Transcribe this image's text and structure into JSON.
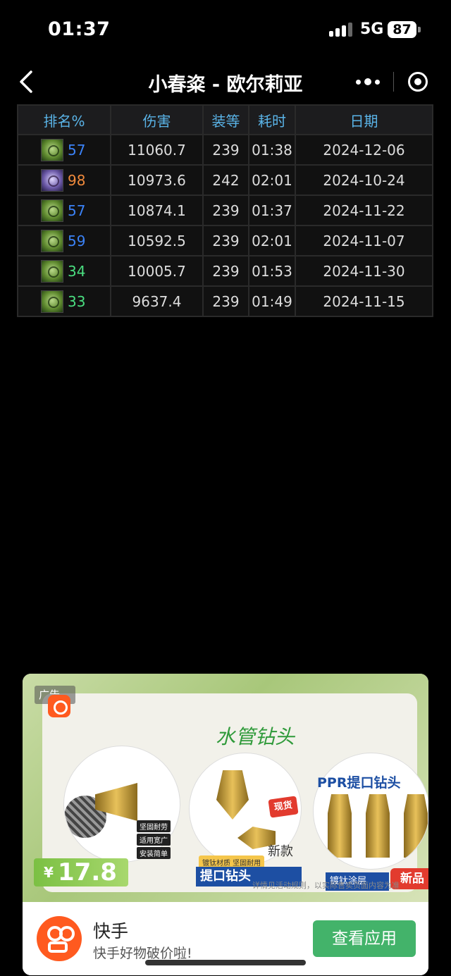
{
  "status": {
    "time": "01:37",
    "network": "5G",
    "battery": "87"
  },
  "nav": {
    "title": "小春粢 - 欧尔莉亚",
    "back_icon": "chevron-left-icon",
    "more_icon": "ellipsis-icon",
    "target_icon": "target-icon"
  },
  "table": {
    "headers": [
      "排名%",
      "伤害",
      "装等",
      "耗时",
      "日期"
    ],
    "rows": [
      {
        "spec": "green",
        "rank": "57",
        "rank_color": "#3b82f6",
        "damage": "11060.7",
        "ilvl": "239",
        "duration": "01:38",
        "date": "2024-12-06"
      },
      {
        "spec": "purple",
        "rank": "98",
        "rank_color": "#f08a3c",
        "damage": "10973.6",
        "ilvl": "242",
        "duration": "02:01",
        "date": "2024-10-24"
      },
      {
        "spec": "green",
        "rank": "57",
        "rank_color": "#3b82f6",
        "damage": "10874.1",
        "ilvl": "239",
        "duration": "01:37",
        "date": "2024-11-22"
      },
      {
        "spec": "green",
        "rank": "59",
        "rank_color": "#3b82f6",
        "damage": "10592.5",
        "ilvl": "239",
        "duration": "02:01",
        "date": "2024-11-07"
      },
      {
        "spec": "green",
        "rank": "34",
        "rank_color": "#4ade80",
        "damage": "10005.7",
        "ilvl": "239",
        "duration": "01:53",
        "date": "2024-11-30"
      },
      {
        "spec": "green",
        "rank": "33",
        "rank_color": "#4ade80",
        "damage": "9637.4",
        "ilvl": "239",
        "duration": "01:49",
        "date": "2024-11-15"
      }
    ]
  },
  "ad": {
    "tag": "广告",
    "headline": "水管钻头",
    "c3_title": "PPR提口钻头",
    "checks": [
      "坚固耐劳",
      "适用宽广",
      "安装简单"
    ],
    "instock": "现货",
    "material": "镀钛材质 坚固耐用",
    "strip1": "提口钻头",
    "strip2": "镀钛涂层",
    "new_badge": "新品",
    "new_style": "新款",
    "price_currency": "¥",
    "price": "17.8",
    "disclaimer": "详情见活动规则，以实际售卖页面内容为准",
    "app_name": "快手",
    "app_slogan": "快手好物破价啦!",
    "button_label": "查看应用"
  }
}
